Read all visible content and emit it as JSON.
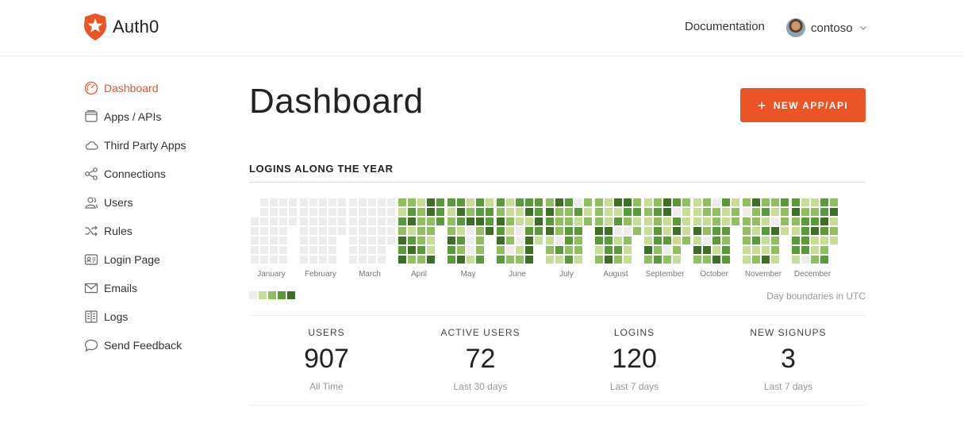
{
  "brand": {
    "name": "Auth0",
    "accent": "#eb5424"
  },
  "header": {
    "documentation_label": "Documentation",
    "user": {
      "name": "contoso"
    }
  },
  "sidebar": {
    "items": [
      {
        "label": "Dashboard",
        "icon": "dashboard-icon",
        "active": true
      },
      {
        "label": "Apps / APIs",
        "icon": "apps-icon"
      },
      {
        "label": "Third Party Apps",
        "icon": "cloud-icon"
      },
      {
        "label": "Connections",
        "icon": "connections-icon"
      },
      {
        "label": "Users",
        "icon": "users-icon"
      },
      {
        "label": "Rules",
        "icon": "shuffle-icon"
      },
      {
        "label": "Login Page",
        "icon": "login-page-icon"
      },
      {
        "label": "Emails",
        "icon": "email-icon"
      },
      {
        "label": "Logs",
        "icon": "logs-icon"
      },
      {
        "label": "Send Feedback",
        "icon": "chat-bubble-icon"
      }
    ]
  },
  "main": {
    "title": "Dashboard",
    "new_app_button": "NEW APP/API",
    "logins_section": {
      "title": "LOGINS ALONG THE YEAR",
      "months": [
        "January",
        "February",
        "March",
        "April",
        "May",
        "June",
        "July",
        "August",
        "September",
        "October",
        "November",
        "December"
      ],
      "timezone_note": "Day boundaries in UTC",
      "legend_colors": [
        "#ececec",
        "#c5dd95",
        "#8fbf5e",
        "#5a9a3b",
        "#3d6e26"
      ]
    },
    "stats": [
      {
        "label": "USERS",
        "value": "907",
        "sub": "All Time"
      },
      {
        "label": "ACTIVE USERS",
        "value": "72",
        "sub": "Last 30 days"
      },
      {
        "label": "LOGINS",
        "value": "120",
        "sub": "Last 7 days"
      },
      {
        "label": "NEW SIGNUPS",
        "value": "3",
        "sub": "Last 7 days"
      }
    ]
  }
}
